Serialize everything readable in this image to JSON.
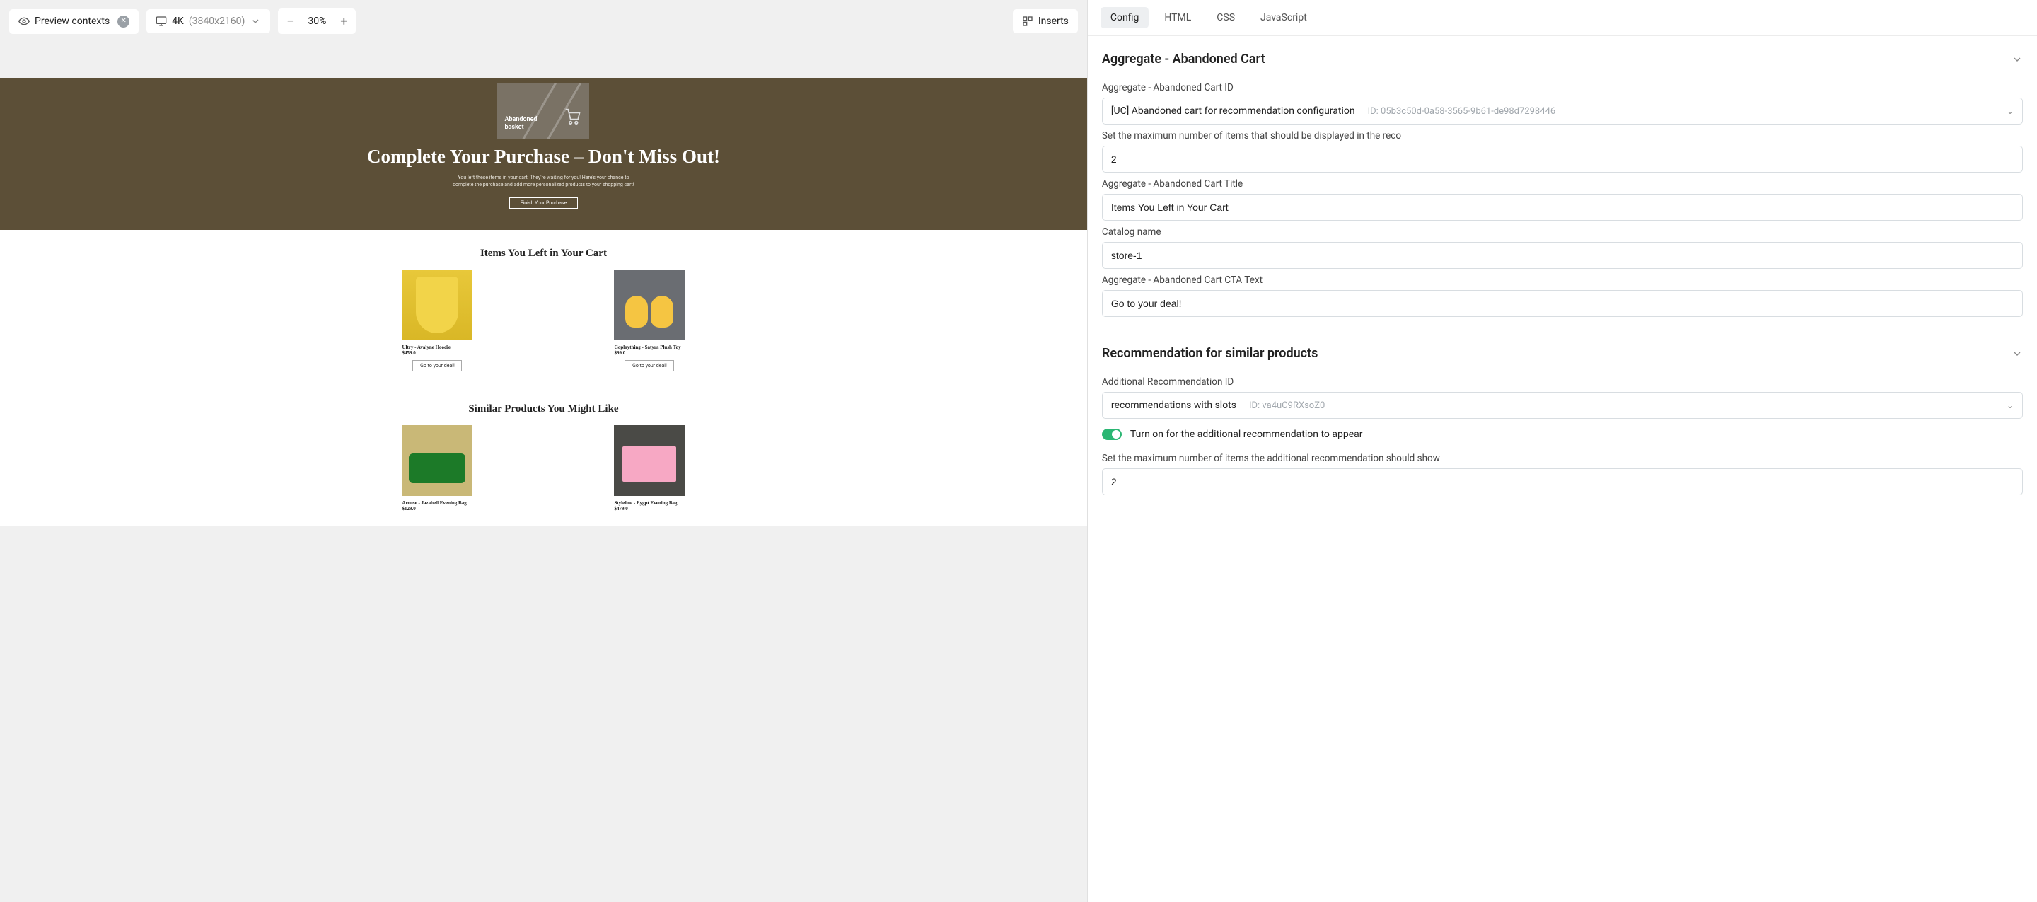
{
  "toolbar": {
    "preview_contexts": "Preview contexts",
    "device_label": "4K",
    "device_res": "(3840x2160)",
    "zoom": "30%",
    "inserts": "Inserts"
  },
  "preview": {
    "hero_tag_line1": "Abandoned",
    "hero_tag_line2": "basket",
    "hero_title": "Complete Your Purchase – Don't Miss Out!",
    "hero_body": "You left these items in your cart. They're waiting for you! Here's your chance to complete the purchase and add more personalized products to your shopping cart!",
    "hero_cta": "Finish Your Purchase",
    "section1_title": "Items You Left in Your Cart",
    "section2_title": "Similar Products You Might Like",
    "deal_cta": "Go to your deal!",
    "products1": [
      {
        "name": "Ultry - Avalyne Hoodie",
        "price": "$459.0"
      },
      {
        "name": "Goplaything - Satyra Plush Toy",
        "price": "$99.0"
      }
    ],
    "products2": [
      {
        "name": "Arouse - Jazabell Evening Bag",
        "price": "$129.0"
      },
      {
        "name": "Styleline - Eygpt Evening Bag",
        "price": "$479.0"
      }
    ]
  },
  "tabs": {
    "config": "Config",
    "html": "HTML",
    "css": "CSS",
    "js": "JavaScript"
  },
  "config": {
    "section1_title": "Aggregate - Abandoned Cart",
    "id_label": "Aggregate - Abandoned Cart ID",
    "id_value": "[UC] Abandoned cart for recommendation configuration",
    "id_meta": "ID: 05b3c50d-0a58-3565-9b61-de98d7298446",
    "max_items_label": "Set the maximum number of items that should be displayed in the reco",
    "max_items_value": "2",
    "title_label": "Aggregate - Abandoned Cart Title",
    "title_value": "Items You Left in Your Cart",
    "catalog_label": "Catalog name",
    "catalog_value": "store-1",
    "cta_label": "Aggregate - Abandoned Cart CTA Text",
    "cta_value": "Go to your deal!",
    "section2_title": "Recommendation for similar products",
    "rec_id_label": "Additional Recommendation ID",
    "rec_id_value": "recommendations with slots",
    "rec_id_meta": "ID: va4uC9RXsoZ0",
    "toggle_label": "Turn on for the additional recommendation to appear",
    "rec_max_label": "Set the maximum number of items the additional recommendation should show",
    "rec_max_value": "2"
  }
}
